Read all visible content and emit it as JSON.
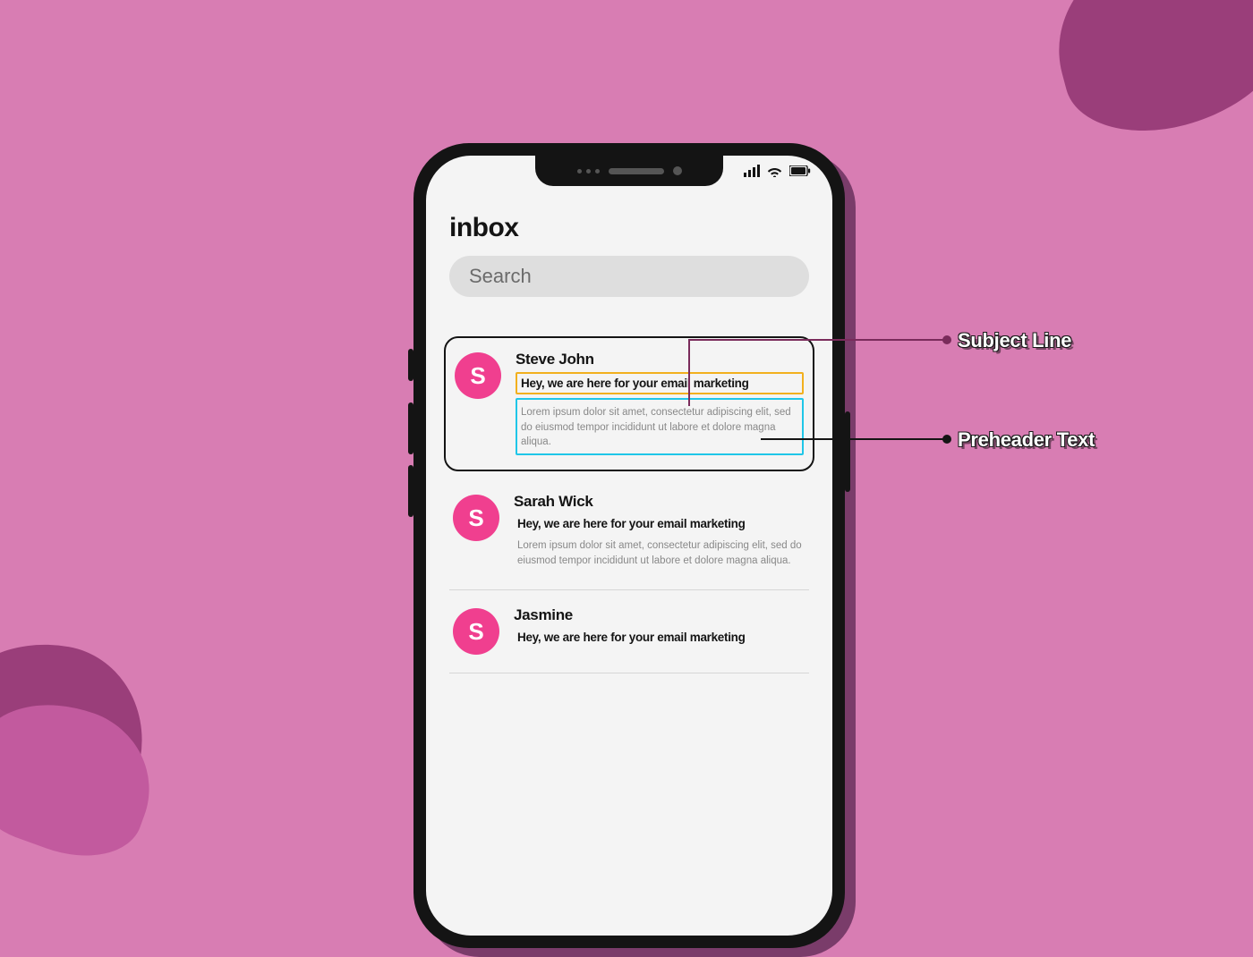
{
  "colors": {
    "bg": "#d87db3",
    "blob_dark": "#9a3e7a",
    "blob_mid": "#c25a9e",
    "phone_frame": "#141414",
    "phone_shadow": "#7a3c6a",
    "screen": "#f4f4f4",
    "avatar": "#f03f8f",
    "subject_highlight": "#f2b01e",
    "preheader_highlight": "#1fc6e8",
    "subject_connector": "#7a2b5b",
    "preheader_connector": "#141414"
  },
  "app": {
    "title": "inbox",
    "search_placeholder": "Search"
  },
  "emails": [
    {
      "avatar_initial": "S",
      "sender": "Steve John",
      "subject": "Hey, we are here for your email marketing",
      "preheader": "Lorem ipsum dolor sit amet, consectetur adipiscing elit, sed do eiusmod tempor incididunt ut labore et dolore magna aliqua."
    },
    {
      "avatar_initial": "S",
      "sender": "Sarah Wick",
      "subject": "Hey, we are here for your email marketing",
      "preheader": "Lorem ipsum dolor sit amet, consectetur adipiscing elit, sed do eiusmod tempor incididunt ut labore et dolore magna aliqua."
    },
    {
      "avatar_initial": "S",
      "sender": "Jasmine",
      "subject": "Hey, we are here for your email marketing",
      "preheader": ""
    }
  ],
  "callouts": {
    "subject_label": "Subject Line",
    "preheader_label": "Preheader Text"
  }
}
